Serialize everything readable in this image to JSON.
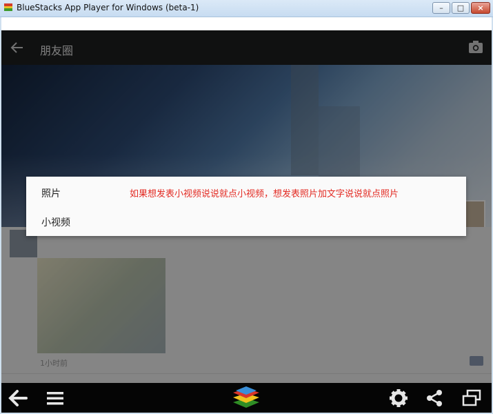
{
  "window": {
    "title": "BlueStacks App Player for Windows (beta-1)",
    "minimize": "–",
    "maximize": "□",
    "close": "×"
  },
  "app": {
    "header_title": "朋友圈",
    "feed": {
      "time_label": "1小时前"
    }
  },
  "dialog": {
    "option_photo": "照片",
    "option_video": "小视频",
    "annotation": "如果想发表小视频说说就点小视频，想发表照片加文字说说就点照片"
  },
  "colors": {
    "annotation": "#e32b23",
    "appbar": "#1e1f20",
    "bottombar": "#050505"
  },
  "icons": {
    "back": "arrow-left-icon",
    "camera": "camera-icon",
    "menu": "hamburger-icon",
    "logo": "bluestacks-logo",
    "settings": "gear-icon",
    "share": "share-icon",
    "window": "windows-icon"
  }
}
